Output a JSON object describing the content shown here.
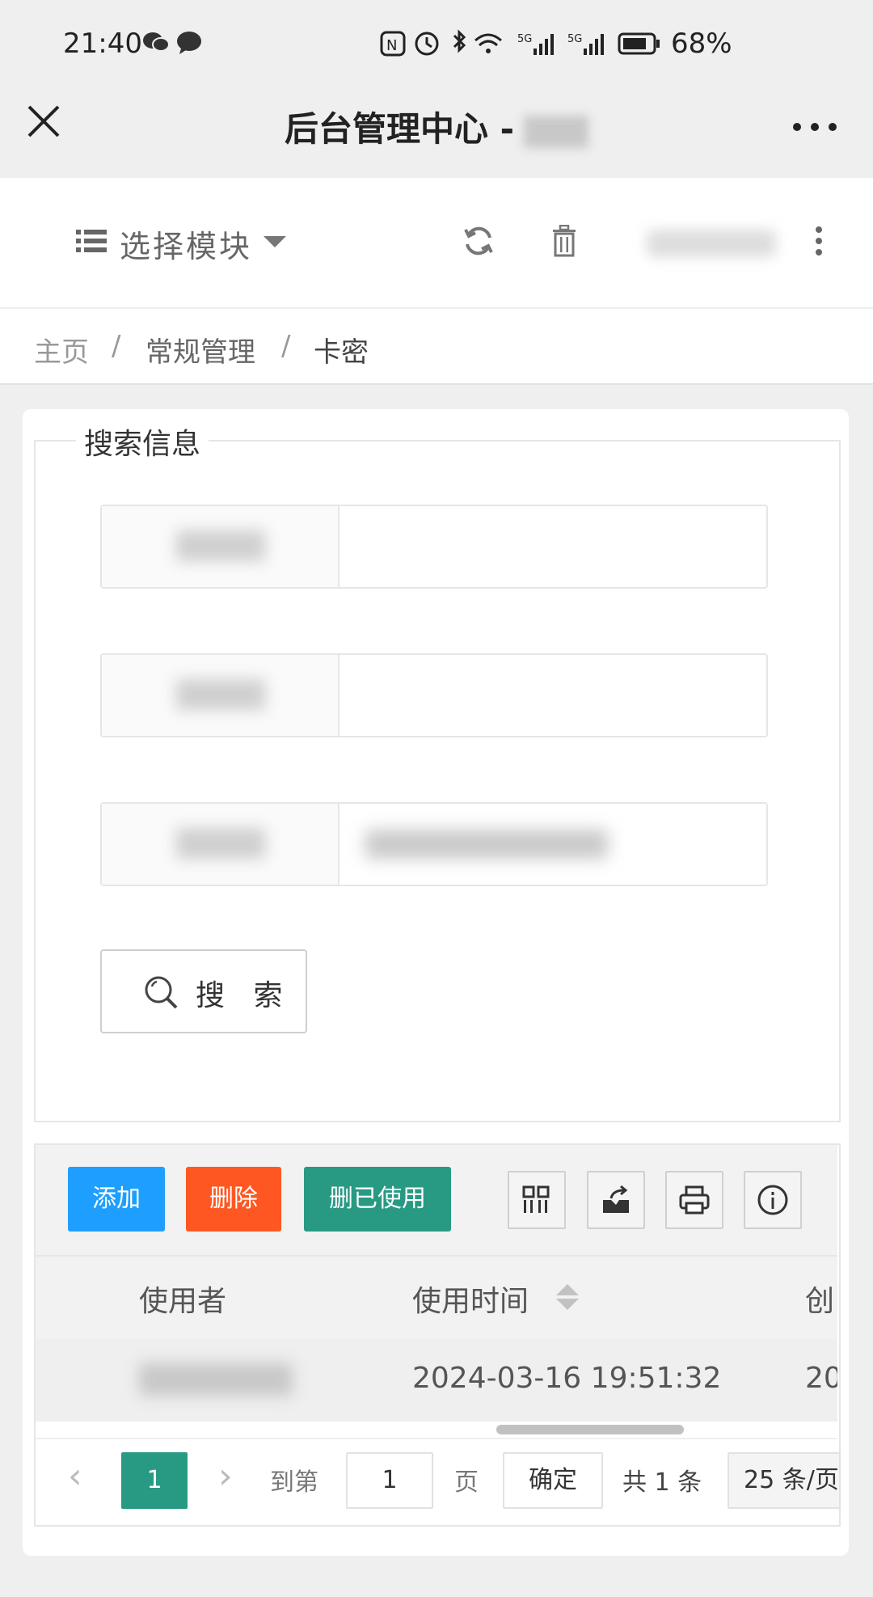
{
  "status_bar": {
    "time": "21:40",
    "battery": "68%"
  },
  "title_bar": {
    "title": "后台管理中心 -"
  },
  "toolbar": {
    "module_label": "选择模块"
  },
  "breadcrumb": [
    "主页",
    "/",
    "常规管理",
    "/",
    "卡密"
  ],
  "search": {
    "legend": "搜索信息",
    "button_label": "搜 索"
  },
  "table_toolbar": {
    "add": "添加",
    "delete": "删除",
    "delete_used": "删已使用"
  },
  "table": {
    "columns": [
      "使用者",
      "使用时间",
      "创"
    ],
    "rows": [
      {
        "used_time": "2024-03-16 19:51:32",
        "created": "20"
      }
    ]
  },
  "pagination": {
    "current": "1",
    "goto_prefix": "到第",
    "goto_value": "1",
    "goto_suffix": "页",
    "confirm": "确定",
    "total": "共 1 条",
    "page_size": "25 条/页"
  }
}
